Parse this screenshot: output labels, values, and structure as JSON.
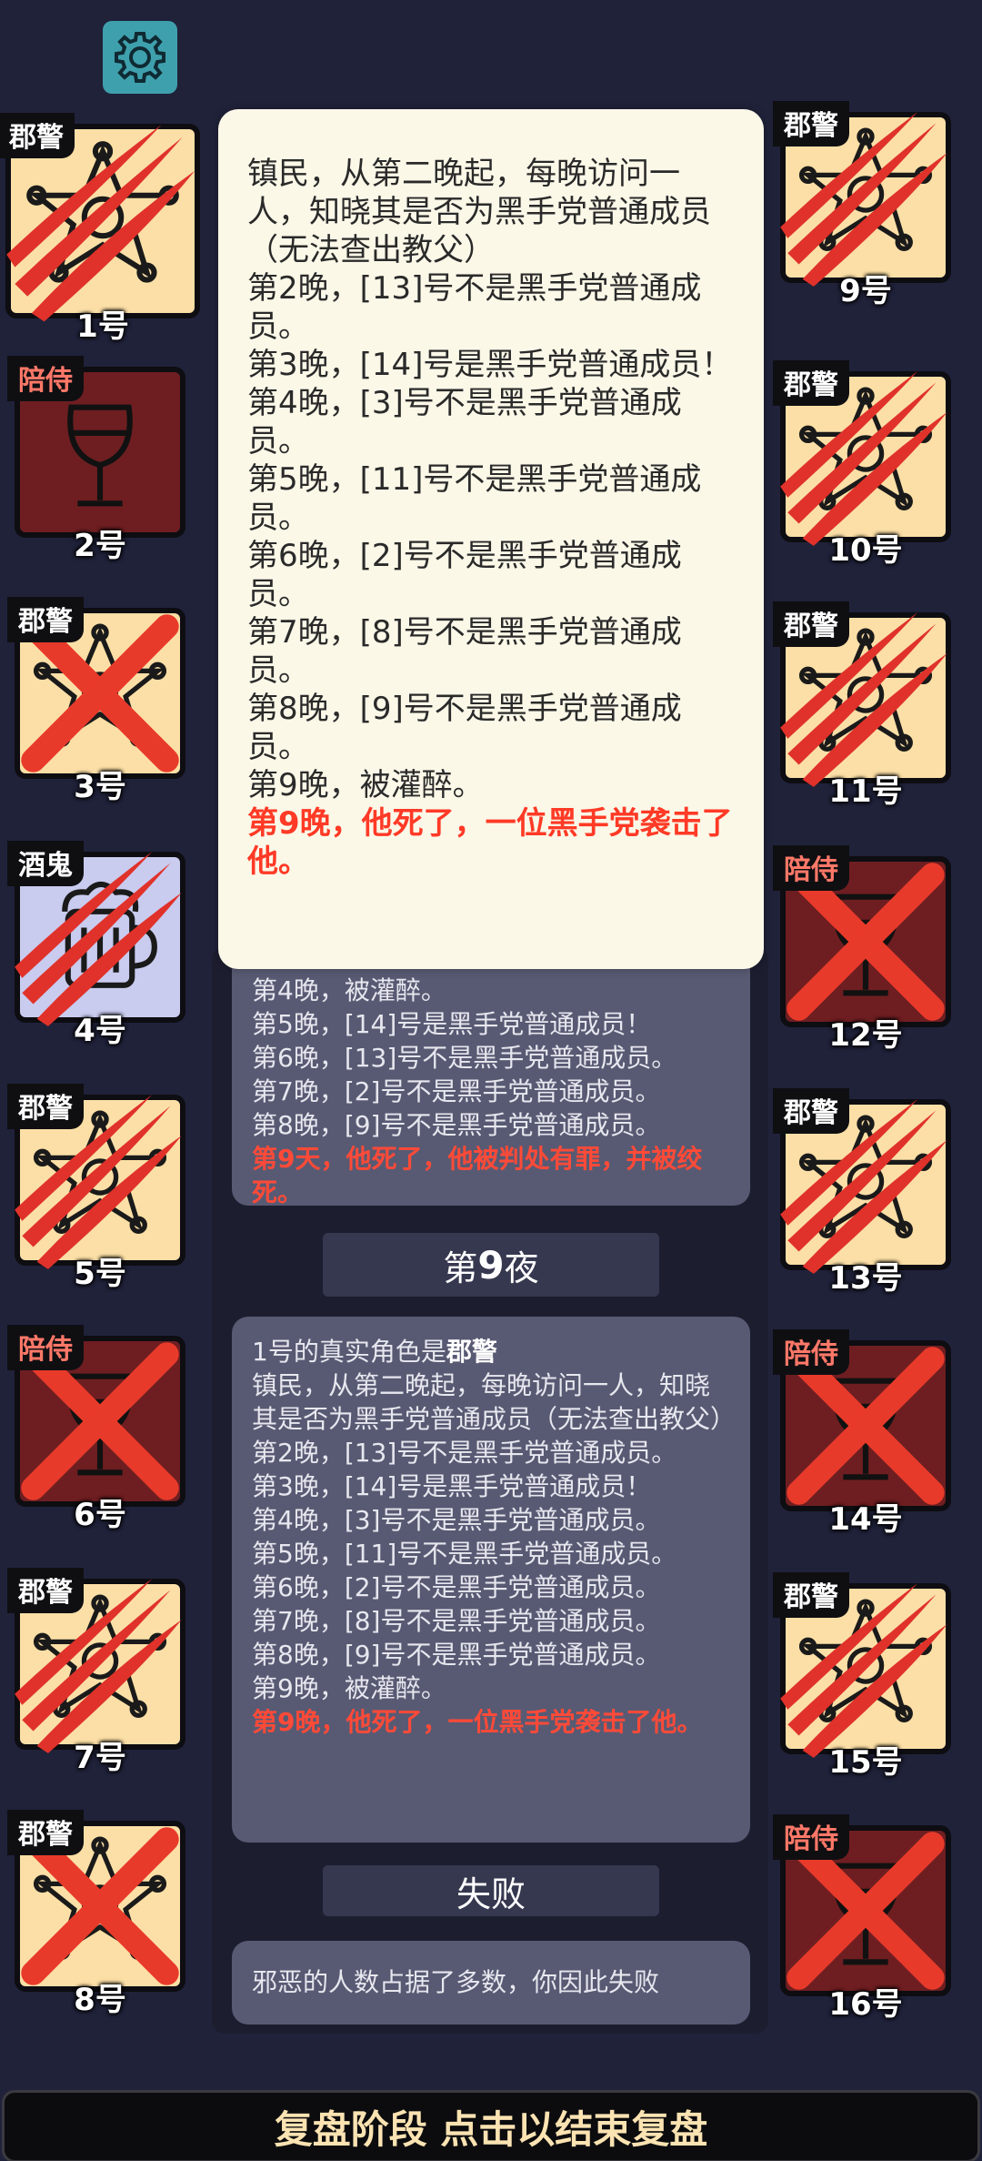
{
  "players": [
    {
      "num": "1号",
      "role": "郡警",
      "role_type": "sheriff",
      "status": "claw"
    },
    {
      "num": "2号",
      "role": "陪侍",
      "role_type": "escort",
      "status": "none"
    },
    {
      "num": "3号",
      "role": "郡警",
      "role_type": "sheriff",
      "status": "cross"
    },
    {
      "num": "4号",
      "role": "酒鬼",
      "role_type": "drunk",
      "status": "claw"
    },
    {
      "num": "5号",
      "role": "郡警",
      "role_type": "sheriff",
      "status": "claw"
    },
    {
      "num": "6号",
      "role": "陪侍",
      "role_type": "escort",
      "status": "cross"
    },
    {
      "num": "7号",
      "role": "郡警",
      "role_type": "sheriff",
      "status": "claw"
    },
    {
      "num": "8号",
      "role": "郡警",
      "role_type": "sheriff",
      "status": "cross"
    },
    {
      "num": "9号",
      "role": "郡警",
      "role_type": "sheriff",
      "status": "claw"
    },
    {
      "num": "10号",
      "role": "郡警",
      "role_type": "sheriff",
      "status": "claw"
    },
    {
      "num": "11号",
      "role": "郡警",
      "role_type": "sheriff",
      "status": "claw"
    },
    {
      "num": "12号",
      "role": "陪侍",
      "role_type": "escort",
      "status": "cross"
    },
    {
      "num": "13号",
      "role": "郡警",
      "role_type": "sheriff",
      "status": "claw"
    },
    {
      "num": "14号",
      "role": "陪侍",
      "role_type": "escort",
      "status": "cross"
    },
    {
      "num": "15号",
      "role": "郡警",
      "role_type": "sheriff",
      "status": "claw"
    },
    {
      "num": "16号",
      "role": "陪侍",
      "role_type": "escort",
      "status": "cross"
    }
  ],
  "popup": {
    "lines": [
      "镇民，从第二晚起，每晚访问一人，知晓其是否为黑手党普通成员（无法查出教父）",
      "第2晚，[13]号不是黑手党普通成员。",
      "第3晚，[14]号是黑手党普通成员！",
      "第4晚，[3]号不是黑手党普通成员。",
      "第5晚，[11]号不是黑手党普通成员。",
      "第6晚，[2]号不是黑手党普通成员。",
      "第7晚，[8]号不是黑手党普通成员。",
      "第8晚，[9]号不是黑手党普通成员。",
      "第9晚，被灌醉。"
    ],
    "death": "第9晚，他死了，一位黑手党袭击了他。"
  },
  "log_top": {
    "lines": [
      "第4晚，被灌醉。",
      "第5晚，[14]号是黑手党普通成员！",
      "第6晚，[13]号不是黑手党普通成员。",
      "第7晚，[2]号不是黑手党普通成员。",
      "第8晚，[9]号不是黑手党普通成员。"
    ],
    "death": "第9天，他死了，他被判处有罪，并被绞死。"
  },
  "night_label": {
    "prefix": "第",
    "number": "9",
    "suffix": "夜"
  },
  "log_night": {
    "role_prefix": "1号的真实角色是",
    "role_name": "郡警",
    "lines": [
      "镇民，从第二晚起，每晚访问一人，知晓其是否为黑手党普通成员（无法查出教父）",
      "第2晚，[13]号不是黑手党普通成员。",
      "第3晚，[14]号是黑手党普通成员！",
      "第4晚，[3]号不是黑手党普通成员。",
      "第5晚，[11]号不是黑手党普通成员。",
      "第6晚，[2]号不是黑手党普通成员。",
      "第7晚，[8]号不是黑手党普通成员。",
      "第8晚，[9]号不是黑手党普通成员。",
      "第9晚，被灌醉。"
    ],
    "death": "第9晚，他死了，一位黑手党袭击了他。"
  },
  "result_label": "失败",
  "result_text": "邪恶的人数占据了多数，你因此失败",
  "bottom_bar": "复盘阶段 点击以结束复盘",
  "colors": {
    "accent_red": "#ff3a26",
    "sheriff_bg": "#fbdfa6",
    "escort_bg": "#6e1e21",
    "drunk_bg": "#c9cbef"
  }
}
